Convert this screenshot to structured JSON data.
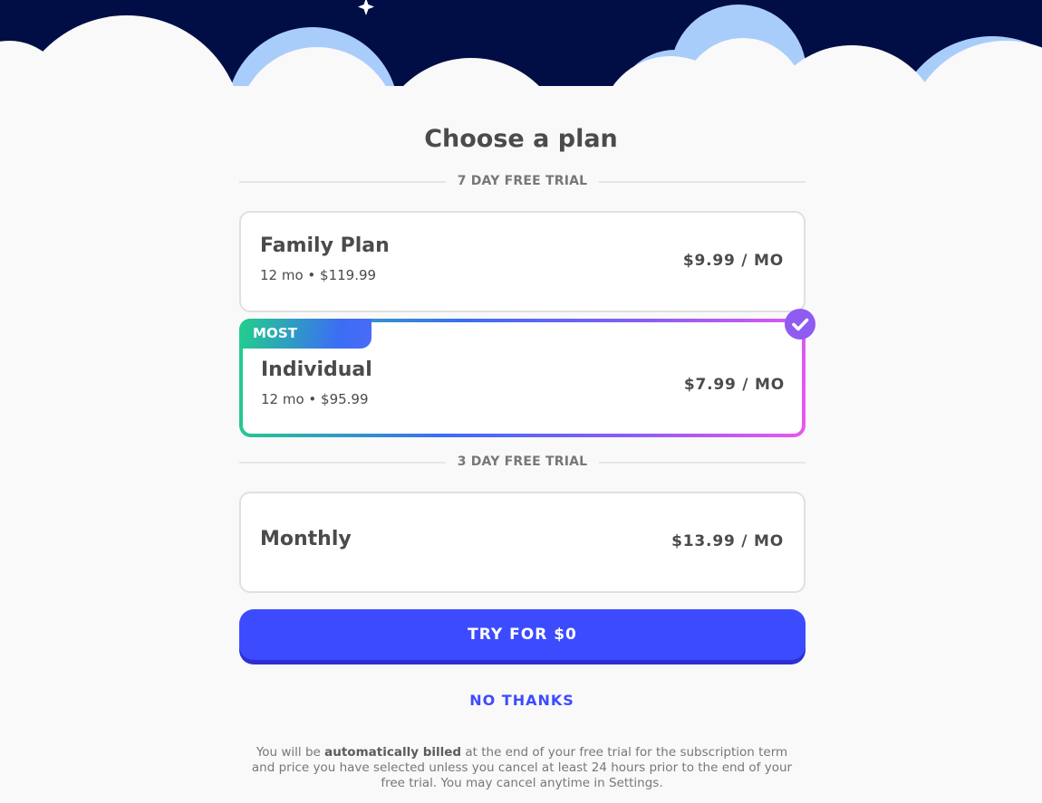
{
  "title": "Choose a plan",
  "sections": [
    {
      "label": "7 DAY FREE TRIAL"
    },
    {
      "label": "3 DAY FREE TRIAL"
    }
  ],
  "plans": [
    {
      "name": "Family Plan",
      "detail": "12 mo • $119.99",
      "price": "$9.99 / MO",
      "selected": false
    },
    {
      "name": "Individual",
      "detail": "12 mo • $95.99",
      "price": "$7.99 / MO",
      "badge": "MOST POPULAR",
      "selected": true
    },
    {
      "name": "Monthly",
      "detail": "",
      "price": "$13.99 / MO",
      "selected": false
    }
  ],
  "cta_label": "TRY FOR $0",
  "decline_label": "NO THANKS",
  "legal": {
    "prefix": "You will be ",
    "bold": "automatically billed",
    "suffix": " at the end of your free trial for the subscription term and price you have selected unless you cancel at least 24 hours prior to the end of your free trial. You may cancel anytime in Settings."
  },
  "colors": {
    "sky": "#000e45",
    "cloud": "#f9f9f9",
    "cloud_shadow": "#a9cdfb",
    "accent": "#3d4bff",
    "check": "#8f5bf0"
  },
  "icons": {
    "sparkle": "four-point-star-icon",
    "selected": "checkmark-circle-icon"
  }
}
